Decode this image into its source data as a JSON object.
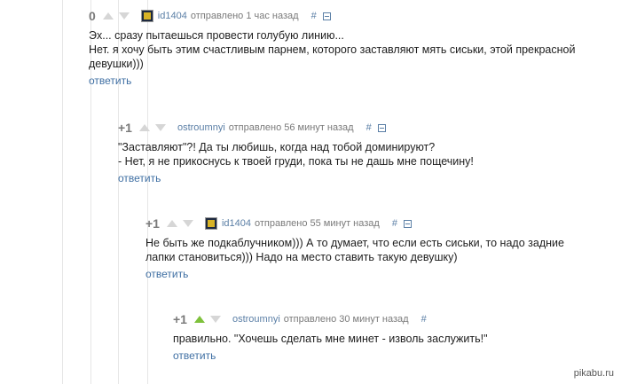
{
  "comments": [
    {
      "rating": "0",
      "user": "id1404",
      "posted": "отправлено 1 час назад",
      "hash": "#",
      "lines": [
        "Эх... сразу пытаешься провести голубую линию...",
        "Нет. я хочу быть этим счастливым парнем, которого заставляют мять сиськи, этой прекрасной",
        "девушки)))"
      ],
      "reply": "ответить"
    },
    {
      "rating": "+1",
      "user": "ostroumnyi",
      "posted": "отправлено 56 минут назад",
      "hash": "#",
      "lines": [
        "\"Заставляют\"?! Да ты любишь, когда над тобой доминируют?",
        "- Нет, я не прикоснусь к твоей груди, пока ты не дашь мне пощечину!"
      ],
      "reply": "ответить"
    },
    {
      "rating": "+1",
      "user": "id1404",
      "posted": "отправлено 55 минут назад",
      "hash": "#",
      "lines": [
        "Не быть же подкаблучником))) А то думает, что если есть сиськи, то надо задние",
        "лапки становиться))) Надо на место ставить такую девушку)"
      ],
      "reply": "ответить"
    },
    {
      "rating": "+1",
      "user": "ostroumnyi",
      "posted": "отправлено 30 минут назад",
      "hash": "#",
      "lines": [
        "правильно. \"Хочешь сделать мне минет - изволь заслужить!\""
      ],
      "reply": "ответить"
    }
  ],
  "watermark": "pikabu.ru",
  "colors": {
    "upvote_active": "#7ec13b",
    "vote_inactive": "#d6d6d6",
    "link": "#5b7fa6"
  },
  "icons": {
    "upvote": "arrow-up-icon",
    "downvote": "arrow-down-icon",
    "collapse": "minus-box-icon"
  }
}
